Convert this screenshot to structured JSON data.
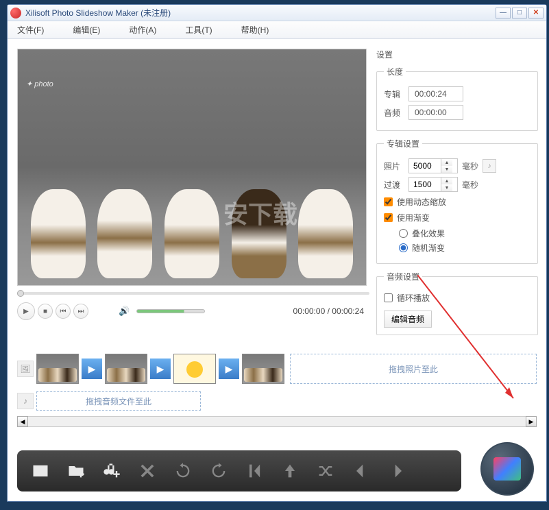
{
  "title": "Xilisoft Photo Slideshow Maker (未注册)",
  "menu": {
    "file": "文件(F)",
    "edit": "编辑(E)",
    "action": "动作(A)",
    "tools": "工具(T)",
    "help": "帮助(H)"
  },
  "playback": {
    "current": "00:00:00",
    "total": "00:00:24",
    "separator": " / "
  },
  "settings": {
    "heading": "设置",
    "length": {
      "legend": "长度",
      "album_label": "专辑",
      "album_time": "00:00:24",
      "audio_label": "音频",
      "audio_time": "00:00:00"
    },
    "album": {
      "legend": "专辑设置",
      "photo_label": "照片",
      "photo_value": "5000",
      "photo_unit": "毫秒",
      "trans_label": "过渡",
      "trans_value": "1500",
      "trans_unit": "毫秒",
      "zoom_label": "使用动态缩放",
      "fade_label": "使用渐变",
      "overlay_label": "叠化效果",
      "random_label": "随机渐变"
    },
    "audio": {
      "legend": "音频设置",
      "loop_label": "循环播放",
      "edit_btn": "编辑音频"
    }
  },
  "timeline": {
    "drop_photos": "拖拽照片至此",
    "drop_audio": "拖拽音频文件至此"
  },
  "watermark_text": "安下载"
}
